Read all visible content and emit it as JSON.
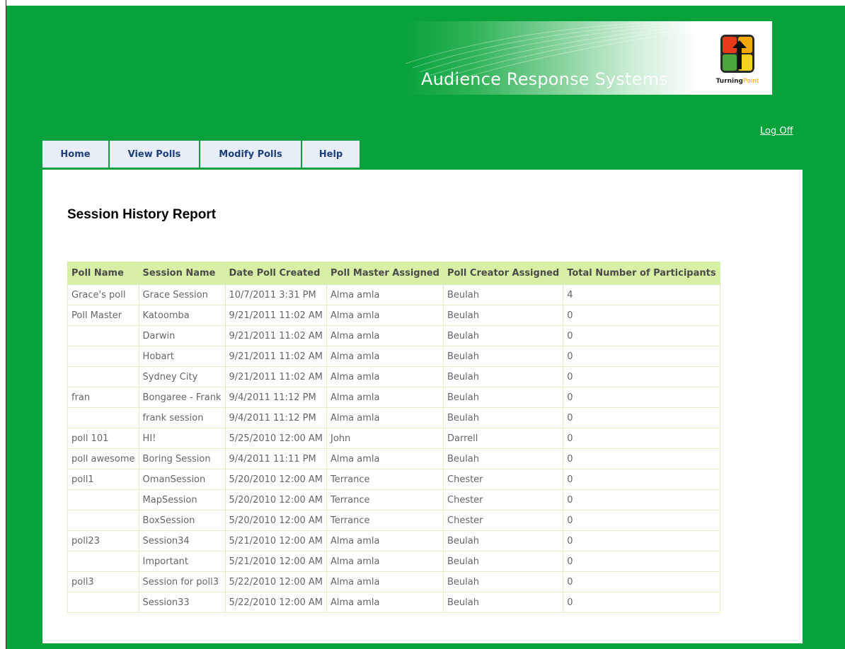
{
  "banner": {
    "title": "Audience Response Systems",
    "logo_word_bold": "Turning",
    "logo_word_light": "Point"
  },
  "header": {
    "logoff": "Log Off"
  },
  "tabs": [
    {
      "label": "Home"
    },
    {
      "label": "View Polls"
    },
    {
      "label": "Modify Polls"
    },
    {
      "label": "Help"
    }
  ],
  "page": {
    "title": "Session History Report"
  },
  "table": {
    "headers": [
      "Poll Name",
      "Session Name",
      "Date Poll Created",
      "Poll Master Assigned",
      "Poll Creator Assigned",
      "Total Number of Participants"
    ],
    "rows": [
      [
        "Grace's poll",
        "Grace Session",
        "10/7/2011 3:31 PM",
        "Alma amla",
        "Beulah",
        "4"
      ],
      [
        "Poll Master",
        "Katoomba",
        "9/21/2011 11:02 AM",
        "Alma amla",
        "Beulah",
        "0"
      ],
      [
        "",
        "Darwin",
        "9/21/2011 11:02 AM",
        "Alma amla",
        "Beulah",
        "0"
      ],
      [
        "",
        "Hobart",
        "9/21/2011 11:02 AM",
        "Alma amla",
        "Beulah",
        "0"
      ],
      [
        "",
        "Sydney City",
        "9/21/2011 11:02 AM",
        "Alma amla",
        "Beulah",
        "0"
      ],
      [
        "fran",
        "Bongaree - Frank",
        "9/4/2011 11:12 PM",
        "Alma amla",
        "Beulah",
        "0"
      ],
      [
        "",
        "frank session",
        "9/4/2011 11:12 PM",
        "Alma amla",
        "Beulah",
        "0"
      ],
      [
        "poll 101",
        "HI!",
        "5/25/2010 12:00 AM",
        "John",
        "Darrell",
        "0"
      ],
      [
        "poll awesome",
        "Boring Session",
        "9/4/2011 11:11 PM",
        "Alma amla",
        "Beulah",
        "0"
      ],
      [
        "poll1",
        "OmanSession",
        "5/20/2010 12:00 AM",
        "Terrance",
        "Chester",
        "0"
      ],
      [
        "",
        "MapSession",
        "5/20/2010 12:00 AM",
        "Terrance",
        "Chester",
        "0"
      ],
      [
        "",
        "BoxSession",
        "5/20/2010 12:00 AM",
        "Terrance",
        "Chester",
        "0"
      ],
      [
        "poll23",
        "Session34",
        "5/21/2010 12:00 AM",
        "Alma amla",
        "Beulah",
        "0"
      ],
      [
        "",
        "Important",
        "5/21/2010 12:00 AM",
        "Alma amla",
        "Beulah",
        "0"
      ],
      [
        "poll3",
        "Session for poll3",
        "5/22/2010 12:00 AM",
        "Alma amla",
        "Beulah",
        "0"
      ],
      [
        "",
        "Session33",
        "5/22/2010 12:00 AM",
        "Alma amla",
        "Beulah",
        "0"
      ]
    ]
  },
  "colors": {
    "frame_green": "#08a23d",
    "tab_bg": "#e8eef8",
    "tab_text": "#1f3f7a",
    "table_header_bg": "#d8f0a6"
  }
}
